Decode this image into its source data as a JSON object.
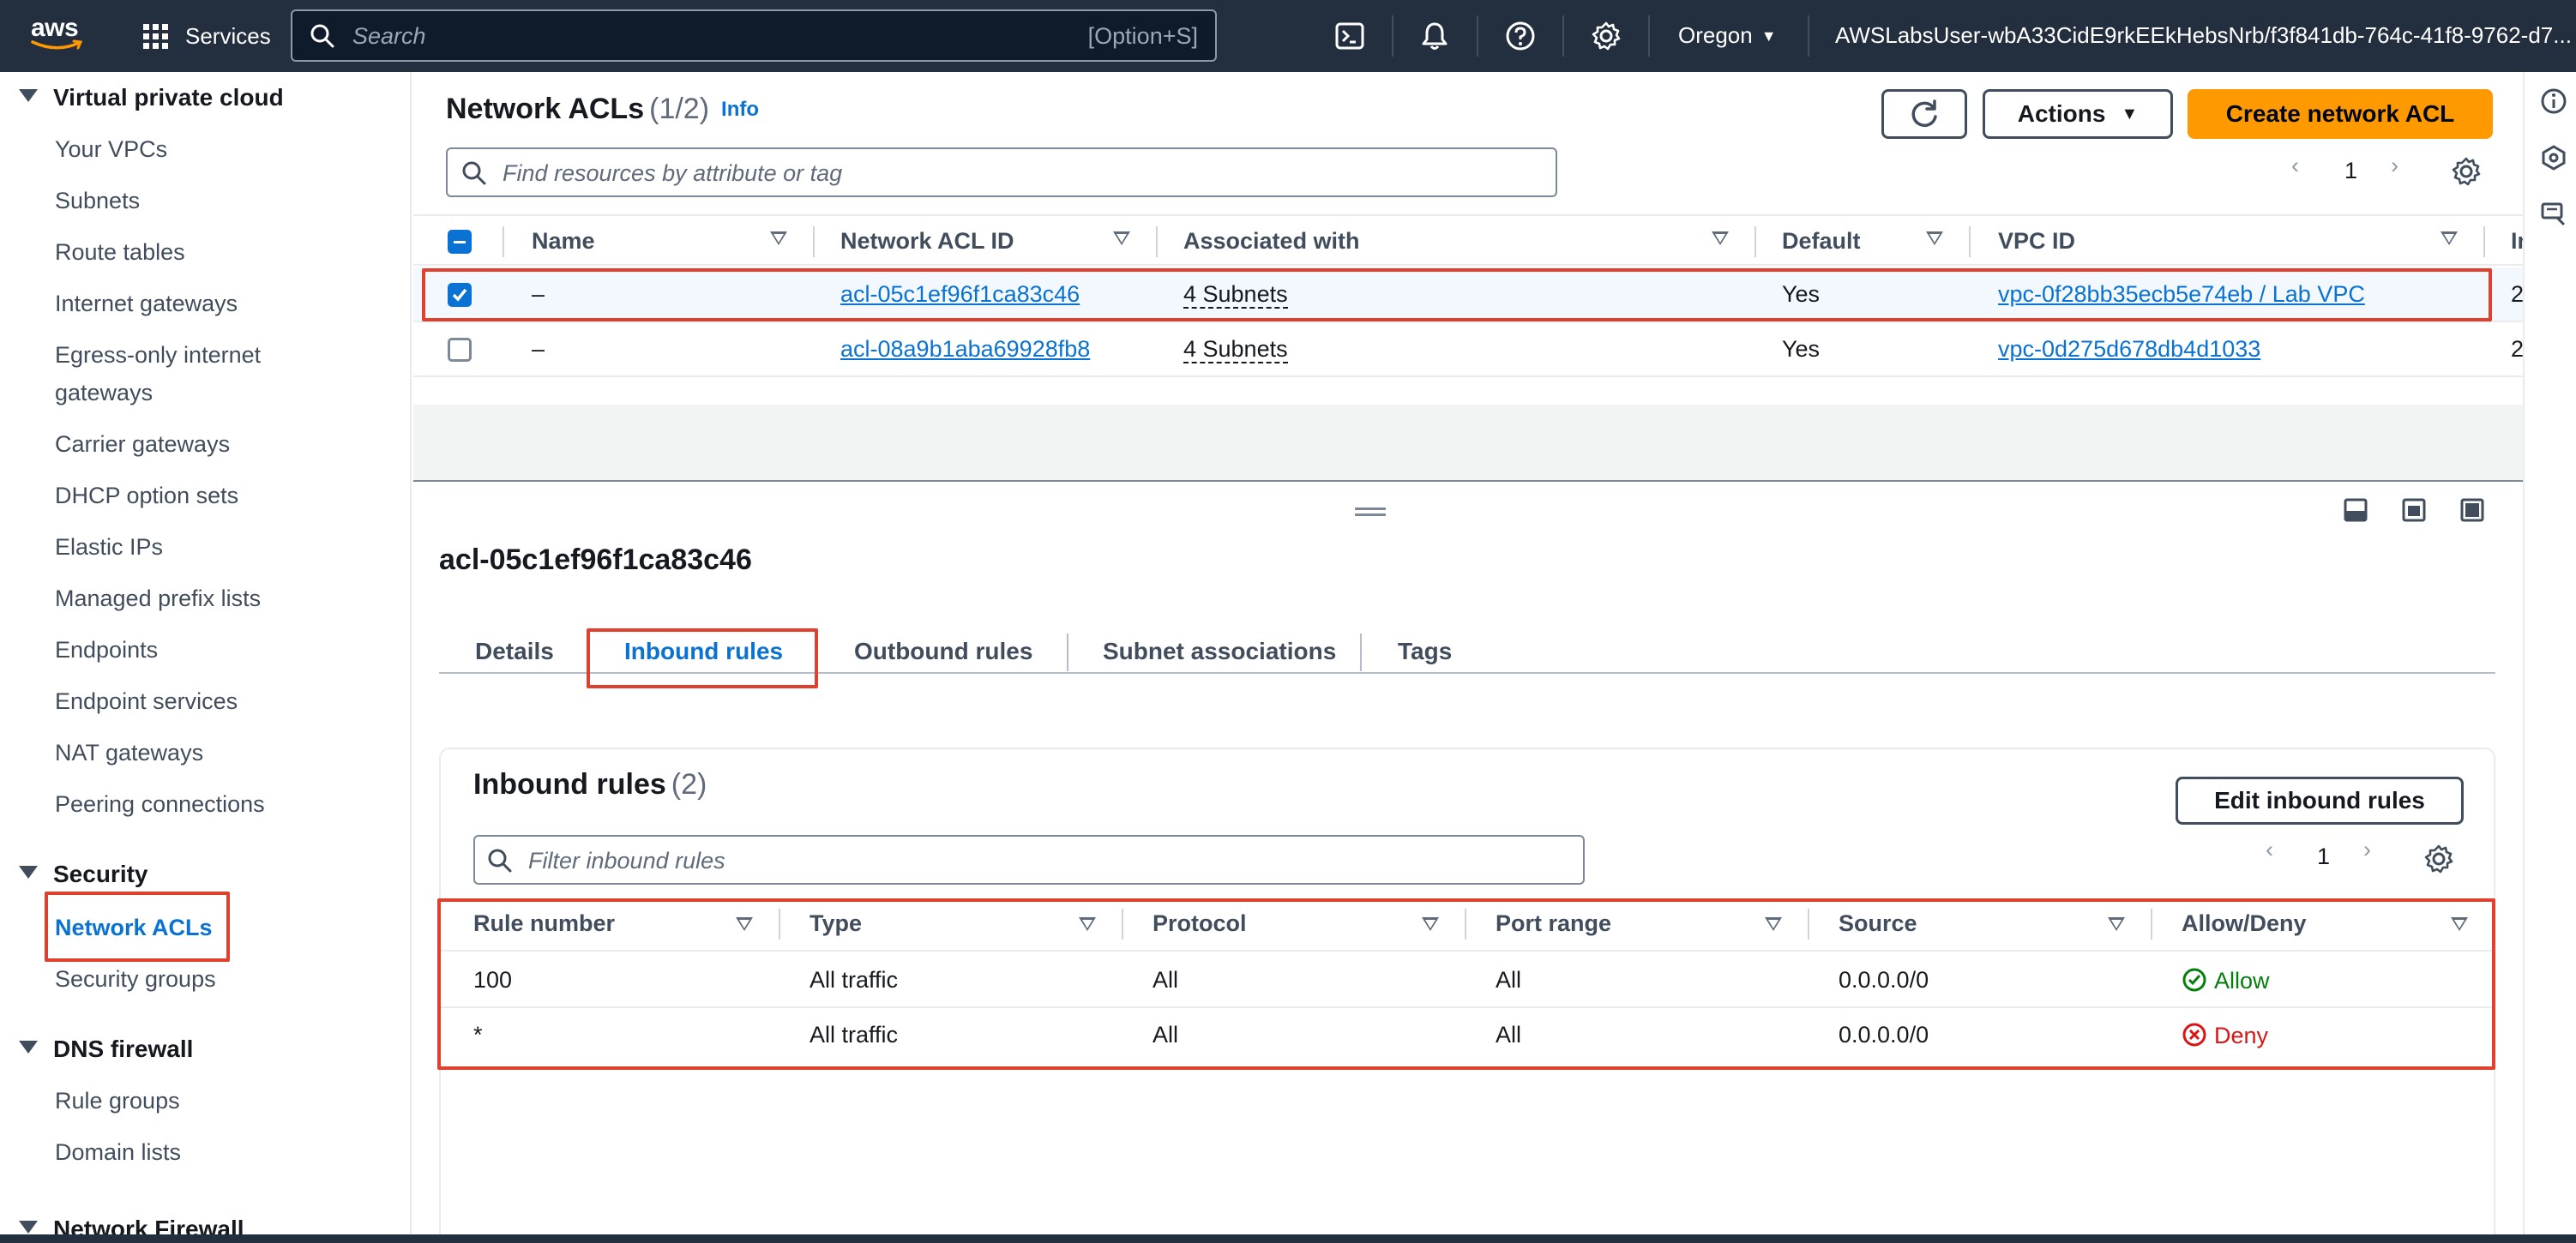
{
  "topnav": {
    "logo_text": "aws",
    "services_label": "Services",
    "search_placeholder": "Search",
    "search_shortcut": "[Option+S]",
    "region": "Oregon",
    "account": "AWSLabsUser-wbA33CidE9rkEEkHebsNrb/f3f841db-764c-41f8-9762-d7..."
  },
  "sidebar": {
    "sections": [
      {
        "title": "Virtual private cloud",
        "items": [
          "Your VPCs",
          "Subnets",
          "Route tables",
          "Internet gateways",
          "Egress-only internet",
          "gateways",
          "Carrier gateways",
          "DHCP option sets",
          "Elastic IPs",
          "Managed prefix lists",
          "Endpoints",
          "Endpoint services",
          "NAT gateways",
          "Peering connections"
        ]
      },
      {
        "title": "Security",
        "items": [
          "Network ACLs",
          "Security groups"
        ]
      },
      {
        "title": "DNS firewall",
        "items": [
          "Rule groups",
          "Domain lists"
        ]
      },
      {
        "title": "Network Firewall",
        "items": []
      }
    ]
  },
  "main": {
    "title": "Network ACLs",
    "count": "(1/2)",
    "info": "Info",
    "actions_label": "Actions",
    "create_label": "Create network ACL",
    "filter_placeholder": "Find resources by attribute or tag",
    "page": "1",
    "columns": [
      "Name",
      "Network ACL ID",
      "Associated with",
      "Default",
      "VPC ID",
      "In"
    ],
    "rows": [
      {
        "name": "–",
        "acl_id": "acl-05c1ef96f1ca83c46",
        "associated": "4 Subnets",
        "default": "Yes",
        "vpc": "vpc-0f28bb35ecb5e74eb / Lab VPC",
        "extra": "2",
        "selected": true
      },
      {
        "name": "–",
        "acl_id": "acl-08a9b1aba69928fb8",
        "associated": "4 Subnets",
        "default": "Yes",
        "vpc": "vpc-0d275d678db4d1033",
        "extra": "2",
        "selected": false
      }
    ]
  },
  "detail": {
    "title": "acl-05c1ef96f1ca83c46",
    "tabs": [
      "Details",
      "Inbound rules",
      "Outbound rules",
      "Subnet associations",
      "Tags"
    ],
    "active_tab": "Inbound rules",
    "rules_title": "Inbound rules",
    "rules_count": "(2)",
    "edit_label": "Edit inbound rules",
    "filter_placeholder": "Filter inbound rules",
    "page": "1",
    "columns": [
      "Rule number",
      "Type",
      "Protocol",
      "Port range",
      "Source",
      "Allow/Deny"
    ],
    "rules": [
      {
        "number": "100",
        "type": "All traffic",
        "protocol": "All",
        "port": "All",
        "source": "0.0.0.0/0",
        "action": "Allow"
      },
      {
        "number": "*",
        "type": "All traffic",
        "protocol": "All",
        "port": "All",
        "source": "0.0.0.0/0",
        "action": "Deny"
      }
    ]
  },
  "colors": {
    "nav_bg": "#232f3e",
    "link": "#0972d3",
    "primary_button": "#ff9900",
    "highlight": "#e0412f",
    "allow": "#037f0c",
    "deny": "#d91515"
  }
}
